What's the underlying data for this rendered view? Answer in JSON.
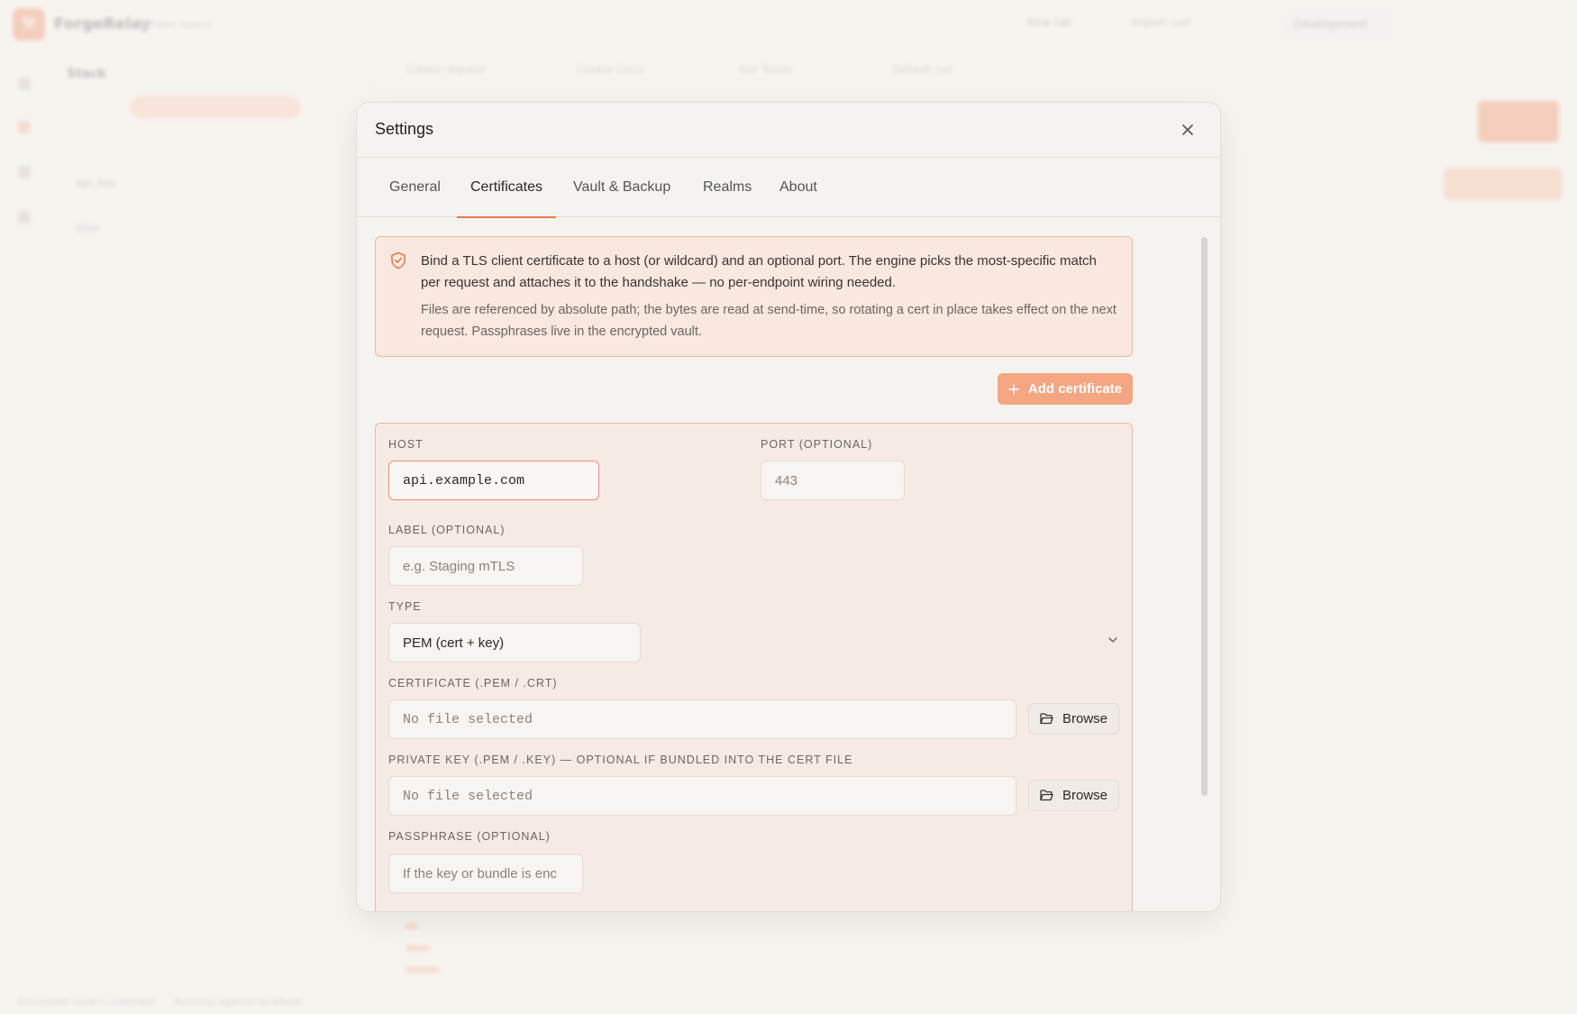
{
  "background": {
    "app_name": "ForgeRelay",
    "app_subtitle": "Sample Space",
    "toolbar": [
      "New tab",
      "Import curl",
      "Development"
    ],
    "sidebar_title": "Stack",
    "sidebar_rows": [
      "api_key",
      "User"
    ],
    "request_tabs": [
      "Create request",
      "Create Certs",
      "Get Token",
      "Default run"
    ],
    "status_left": "Encrypted vault is unlocked",
    "status_right": "Running against localhost"
  },
  "dialog": {
    "title": "Settings",
    "tabs": [
      {
        "label": "General"
      },
      {
        "label": "Certificates"
      },
      {
        "label": "Vault & Backup"
      },
      {
        "label": "Realms"
      },
      {
        "label": "About"
      }
    ],
    "active_tab": "Certificates"
  },
  "certificates": {
    "info_primary": "Bind a TLS client certificate to a host (or wildcard) and an optional port. The engine picks the most-specific match per request and attaches it to the handshake — no per-endpoint wiring needed.",
    "info_secondary": "Files are referenced by absolute path; the bytes are read at send-time, so rotating a cert in place takes effect on the next request. Passphrases live in the encrypted vault.",
    "add_button": "Add certificate",
    "form": {
      "host_label": "HOST",
      "host_value": "api.example.com",
      "port_label": "PORT (OPTIONAL)",
      "port_placeholder": "443",
      "label_label": "LABEL (OPTIONAL)",
      "label_placeholder": "e.g. Staging mTLS",
      "type_label": "TYPE",
      "type_value": "PEM (cert + key)",
      "cert_label": "CERTIFICATE (.PEM / .CRT)",
      "cert_value": "No file selected",
      "key_label": "PRIVATE KEY (.PEM / .KEY) — OPTIONAL IF BUNDLED INTO THE CERT FILE",
      "key_value": "No file selected",
      "browse_label": "Browse",
      "passphrase_label": "PASSPHRASE (OPTIONAL)",
      "passphrase_placeholder": "If the key or bundle is enc"
    }
  },
  "colors": {
    "accent": "#e7784d",
    "accent_soft": "#f4a683",
    "card_bg": "#f6ebe4",
    "info_bg": "#f9e8df"
  }
}
